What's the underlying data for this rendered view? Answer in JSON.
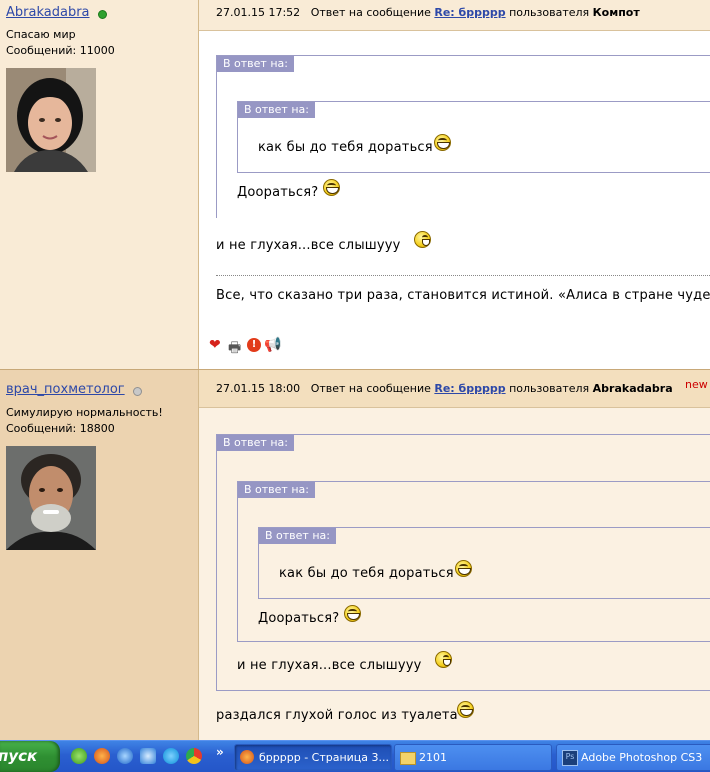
{
  "posts": [
    {
      "username": "Abrakadabra",
      "online": true,
      "status": "Спасаю мир",
      "messages": "Сообщений: 11000",
      "header": {
        "date": "27.01.15 17:52",
        "reply_text": "Ответ на сообщение",
        "reply_link": "Re: брpppp",
        "of_user_text": "пользователя",
        "reply_user": "Компот"
      },
      "quote_label_outer": "В ответ на:",
      "quote_label_inner": "В ответ на:",
      "inner_quote_text": "как бы до тебя дораться",
      "outer_quote_text": "Дооpаться?",
      "body_text": "и не глухая...все слышууу",
      "signature": "Все, что сказано три раза, становится истиной. «Алиса в стране чудес»"
    },
    {
      "username": "врач_похметолог",
      "online": false,
      "status": "Симулирую нормальность!",
      "messages": "Сообщений: 18800",
      "header": {
        "date": "27.01.15 18:00",
        "reply_text": "Ответ на сообщение",
        "reply_link": "Re: брpppp",
        "of_user_text": "пользователя",
        "reply_user": "Abrakadabra",
        "new_mark": "new"
      },
      "quote_label_1": "В ответ на:",
      "quote_label_2": "В ответ на:",
      "quote_label_3": "В ответ на:",
      "q3_text": "как бы до тебя дораться",
      "q2_text": "Дооpаться?",
      "q1_text": "и не глухая...все слышууу",
      "body_text": "раздался глухой голос из туалета"
    }
  ],
  "taskbar": {
    "start_label": "пуск",
    "chevron": "»",
    "buttons": [
      {
        "label": "брpppp - Страница 3..."
      },
      {
        "label": "2101"
      },
      {
        "label": "Adobe Photoshop CS3"
      }
    ]
  }
}
